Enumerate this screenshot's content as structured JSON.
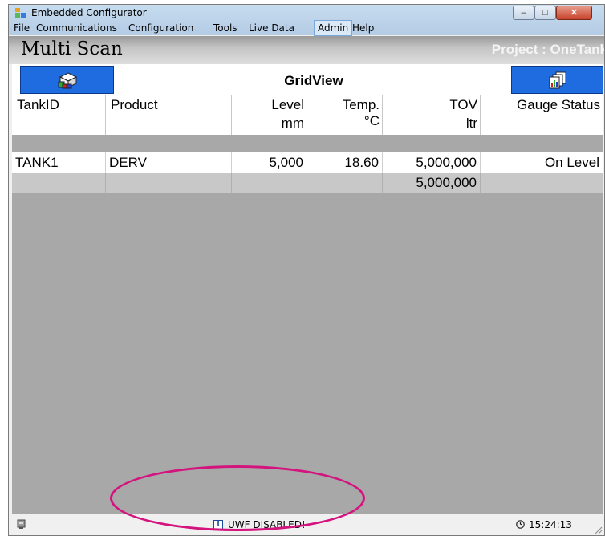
{
  "window": {
    "title": "Embedded Configurator",
    "controls": {
      "minimize": "–",
      "maximize": "□",
      "close": "✕"
    }
  },
  "menu": {
    "items": [
      "File",
      "Communications",
      "Configuration",
      "Tools",
      "Live Data",
      "Admin",
      "Help"
    ],
    "active": "Admin"
  },
  "header": {
    "title": "Multi Scan",
    "project": "Project : OneTank"
  },
  "toolbar": {
    "grid_title": "GridView",
    "left_button_icon": "stack-boxes-icon",
    "right_button_icon": "chart-report-icon",
    "button_color": "#1f6ce0"
  },
  "grid": {
    "columns": [
      {
        "name": "TankID",
        "unit": ""
      },
      {
        "name": "Product",
        "unit": ""
      },
      {
        "name": "Level",
        "unit": "mm"
      },
      {
        "name": "Temp.",
        "unit": "°C"
      },
      {
        "name": "TOV",
        "unit": "ltr"
      },
      {
        "name": "Gauge Status",
        "unit": ""
      }
    ],
    "rows": [
      {
        "tank_id": "TANK1",
        "product": "DERV",
        "level": "5,000",
        "temp": "18.60",
        "tov": "5,000,000",
        "gauge_status": "On Level"
      }
    ],
    "totals": {
      "tov": "5,000,000"
    }
  },
  "status": {
    "uwf_icon_label": "i",
    "uwf_text": "UWF DISABLED!",
    "time": "15:24:13"
  },
  "colors": {
    "content_bg": "#a8a8a8",
    "highlight_ring": "#d4147e"
  }
}
